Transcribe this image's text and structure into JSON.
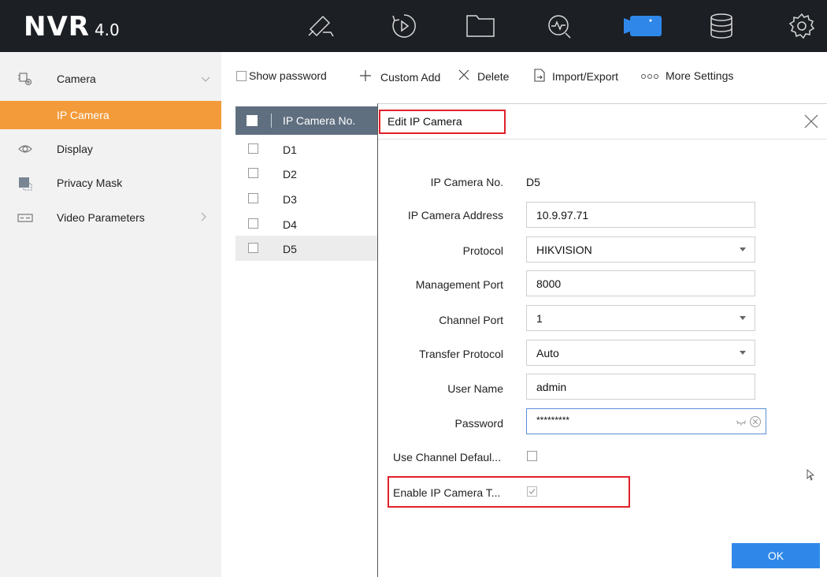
{
  "app": {
    "brand": "NVR",
    "version": "4.0"
  },
  "topnav": [
    {
      "icon": "live-view-camera-icon"
    },
    {
      "icon": "playback-icon"
    },
    {
      "icon": "file-folder-icon"
    },
    {
      "icon": "smart-analysis-icon"
    },
    {
      "icon": "camera-config-icon",
      "active": true
    },
    {
      "icon": "storage-icon"
    },
    {
      "icon": "system-settings-gear-icon"
    }
  ],
  "sidebar": {
    "items": [
      {
        "label": "Camera",
        "icon": "camera-settings-icon",
        "expanded": true
      },
      {
        "label": "IP Camera",
        "active": true
      },
      {
        "label": "Display",
        "icon": "eye-icon"
      },
      {
        "label": "Privacy Mask",
        "icon": "privacy-mask-icon"
      },
      {
        "label": "Video Parameters",
        "icon": "video-params-icon"
      }
    ]
  },
  "toolbar": {
    "show_password": "Show password",
    "custom_add": "Custom Add",
    "delete": "Delete",
    "import_export": "Import/Export",
    "more_settings": "More Settings"
  },
  "table": {
    "header": "IP Camera No.",
    "rows": [
      "D1",
      "D2",
      "D3",
      "D4",
      "D5"
    ],
    "selected": "D5"
  },
  "dialog": {
    "title": "Edit IP Camera",
    "fields": {
      "camera_no_label": "IP Camera No.",
      "camera_no_value": "D5",
      "address_label": "IP Camera Address",
      "address_value": "10.9.97.71",
      "protocol_label": "Protocol",
      "protocol_value": "HIKVISION",
      "mgmt_port_label": "Management Port",
      "mgmt_port_value": "8000",
      "channel_port_label": "Channel Port",
      "channel_port_value": "1",
      "transfer_label": "Transfer Protocol",
      "transfer_value": "Auto",
      "username_label": "User Name",
      "username_value": "admin",
      "password_label": "Password",
      "password_value": "*********",
      "use_default_label": "Use Channel Defaul...",
      "use_default_checked": false,
      "enable_label": "Enable IP Camera T...",
      "enable_checked": true
    },
    "ok": "OK"
  },
  "colors": {
    "topbar": "#1c1f24",
    "accent_orange": "#f39b3a",
    "active_nav_blue": "#2f88e9",
    "table_header": "#5f6f80",
    "highlight_red": "#e0212b"
  }
}
